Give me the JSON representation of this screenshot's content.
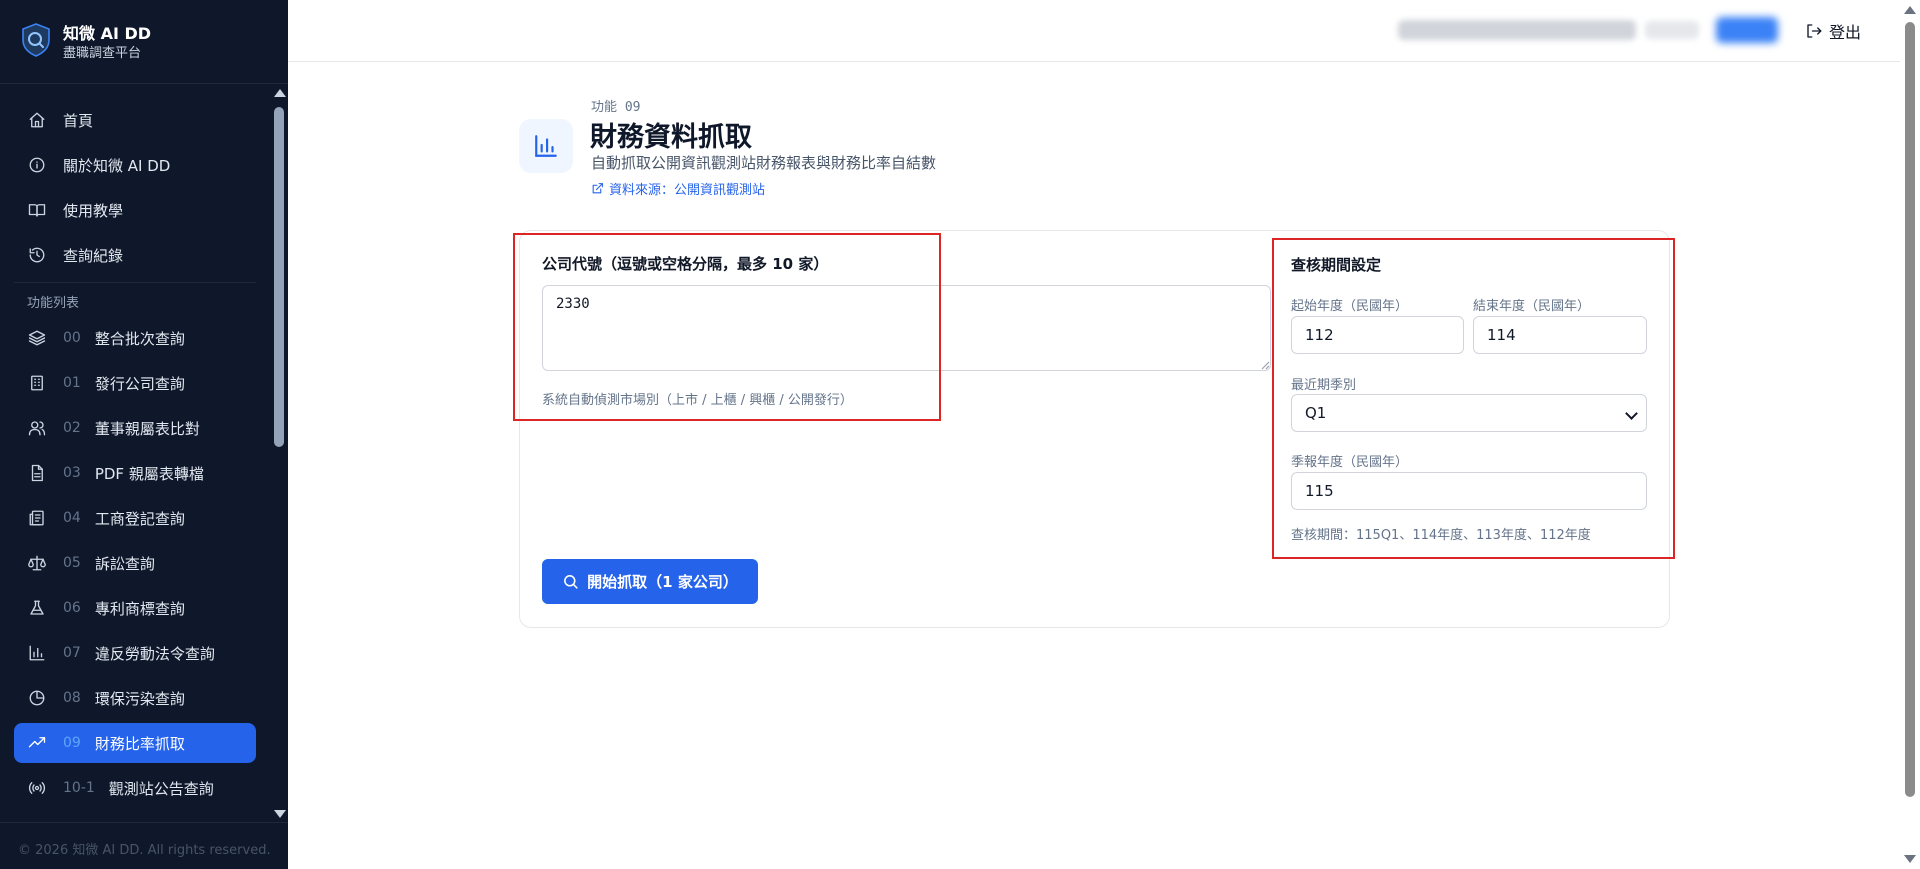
{
  "app": {
    "name": "知微 AI DD",
    "subtitle": "盡職調查平台",
    "footer": "© 2026 知微 AI DD. All rights reserved."
  },
  "sidebar": {
    "top_items": [
      {
        "label": "首頁",
        "icon": "home-icon"
      },
      {
        "label": "關於知微 AI DD",
        "icon": "info-icon"
      },
      {
        "label": "使用教學",
        "icon": "book-icon"
      },
      {
        "label": "查詢紀錄",
        "icon": "history-icon"
      }
    ],
    "section_label": "功能列表",
    "feature_items": [
      {
        "num": "00",
        "label": "整合批次查詢",
        "icon": "layers-icon"
      },
      {
        "num": "01",
        "label": "發行公司查詢",
        "icon": "building-icon"
      },
      {
        "num": "02",
        "label": "董事親屬表比對",
        "icon": "users-icon"
      },
      {
        "num": "03",
        "label": "PDF 親屬表轉檔",
        "icon": "file-icon"
      },
      {
        "num": "04",
        "label": "工商登記查詢",
        "icon": "registry-icon"
      },
      {
        "num": "05",
        "label": "訴訟查詢",
        "icon": "scale-icon"
      },
      {
        "num": "06",
        "label": "專利商標查詢",
        "icon": "flask-icon"
      },
      {
        "num": "07",
        "label": "違反勞動法令查詢",
        "icon": "bar-chart-icon"
      },
      {
        "num": "08",
        "label": "環保污染查詢",
        "icon": "pie-chart-icon"
      },
      {
        "num": "09",
        "label": "財務比率抓取",
        "icon": "trending-up-icon",
        "active": true
      },
      {
        "num": "10-1",
        "label": "觀測站公告查詢",
        "icon": "broadcast-icon"
      }
    ]
  },
  "header": {
    "logout_label": "登出"
  },
  "page": {
    "func_label": "功能 09",
    "title": "財務資料抓取",
    "description": "自動抓取公開資訊觀測站財務報表與財務比率自結數",
    "source_link": "資料來源：公開資訊觀測站"
  },
  "form": {
    "company_label": "公司代號（逗號或空格分隔，最多 10 家）",
    "company_value": "2330",
    "company_hint": "系統自動偵測市場別（上市 / 上櫃 / 興櫃 / 公開發行）",
    "period_title": "查核期間設定",
    "start_year_label": "起始年度（民國年）",
    "start_year_value": "112",
    "end_year_label": "結束年度（民國年）",
    "end_year_value": "114",
    "quarter_label": "最近期季別",
    "quarter_value": "Q1",
    "quarter_year_label": "季報年度（民國年）",
    "quarter_year_value": "115",
    "period_summary": "查核期間：115Q1、114年度、113年度、112年度",
    "submit_label": "開始抓取（1 家公司）"
  },
  "colors": {
    "sidebar_bg": "#0f172a",
    "accent": "#2563eb",
    "highlight_box": "#dc2626"
  }
}
